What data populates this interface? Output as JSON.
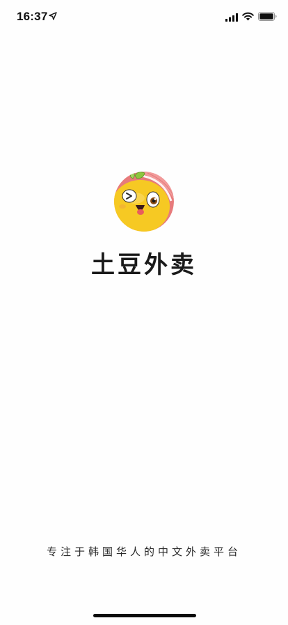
{
  "status_bar": {
    "time": "16:37",
    "icons": [
      "location-arrow-icon",
      "cellular-signal-icon",
      "wifi-icon",
      "battery-icon"
    ]
  },
  "splash": {
    "logo": "smiling-potato-mascot-logo",
    "app_name": "土豆外卖",
    "tagline": "专注于韩国华人的中文外卖平台"
  },
  "colors": {
    "background": "#fefefe",
    "logo_yellow": "#f6c923",
    "logo_pink": "#e77b7b",
    "logo_leaf": "#8dc63f",
    "text_dark": "#1a1a1a"
  }
}
